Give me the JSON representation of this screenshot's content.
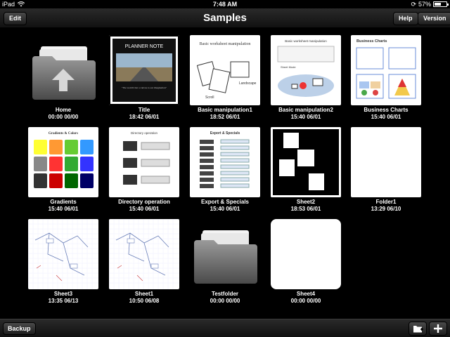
{
  "status": {
    "device": "iPad",
    "time": "7:48 AM",
    "battery": "57%",
    "battery_level": 0.57
  },
  "nav": {
    "title": "Samples",
    "edit": "Edit",
    "help": "Help",
    "version": "Version"
  },
  "toolbar": {
    "backup": "Backup",
    "new_folder_icon": "new-folder-icon",
    "add_icon": "plus-icon"
  },
  "items": [
    {
      "name": "Home",
      "date": "00:00 00/00",
      "kind": "home-folder"
    },
    {
      "name": "Title",
      "date": "18:42 06/01",
      "kind": "title",
      "logo_text": "PLANNER NOTE",
      "caption": "\"The world's but a canvas to our imagination\""
    },
    {
      "name": "Basic manipulation1",
      "date": "18:52 06/01",
      "kind": "manip1",
      "heading": "Basic worksheet manipulation",
      "scroll": "Scroll",
      "landscape": "Landscape"
    },
    {
      "name": "Basic manipulation2",
      "date": "15:40 06/01",
      "kind": "manip2",
      "heading": "Basic worksheet manipulation",
      "sheet_mode": "Sheet Mode"
    },
    {
      "name": "Business Charts",
      "date": "15:40 06/01",
      "kind": "business",
      "heading": "Business Charts"
    },
    {
      "name": "Gradients",
      "date": "15:40 06/01",
      "kind": "gradients",
      "heading": "Gradients & Colors"
    },
    {
      "name": "Directory operation",
      "date": "15:40 06/01",
      "kind": "directory",
      "heading": "Directory operation"
    },
    {
      "name": "Export & Specials",
      "date": "15:40 06/01",
      "kind": "export",
      "heading": "Export & Specials"
    },
    {
      "name": "Sheet2",
      "date": "18:53 06/01",
      "kind": "sheet2"
    },
    {
      "name": "Folder1",
      "date": "13:29 06/10",
      "kind": "blank"
    },
    {
      "name": "Sheet3",
      "date": "13:35 06/13",
      "kind": "sketch"
    },
    {
      "name": "Sheet1",
      "date": "10:50 06/08",
      "kind": "sketch"
    },
    {
      "name": "Testfolder",
      "date": "00:00 00/00",
      "kind": "folder"
    },
    {
      "name": "Sheet4",
      "date": "00:00 00/00",
      "kind": "blank-round"
    }
  ],
  "colors": {
    "nav_top": "#2a2a2a",
    "nav_bottom": "#111111",
    "background": "#000000"
  }
}
